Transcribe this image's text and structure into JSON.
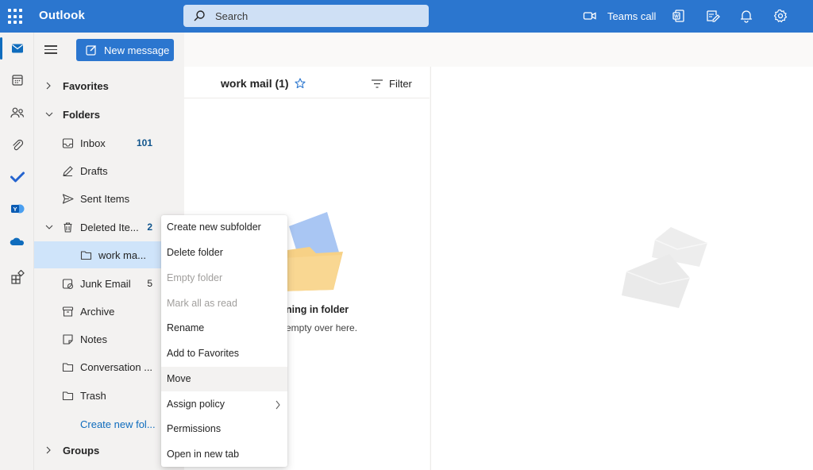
{
  "topbar": {
    "app_title": "Outlook",
    "search_placeholder": "Search",
    "teams_call_label": "Teams call",
    "icons": [
      "app-launcher-icon",
      "search-icon",
      "video-icon",
      "office-icon",
      "sticky-notes-icon",
      "bell-icon",
      "gear-icon"
    ]
  },
  "rail": {
    "items": [
      "mail",
      "calendar",
      "people",
      "attachments",
      "to-do",
      "yammer",
      "onedrive",
      "apps"
    ]
  },
  "folders": {
    "new_message_label": "New message",
    "favorites_label": "Favorites",
    "folders_label": "Folders",
    "groups_label": "Groups",
    "create_new_folder_label": "Create new fol...",
    "items": [
      {
        "label": "Inbox",
        "count": "101"
      },
      {
        "label": "Drafts",
        "count": ""
      },
      {
        "label": "Sent Items",
        "count": ""
      },
      {
        "label": "Deleted Ite...",
        "count": "2"
      },
      {
        "label": "work ma...",
        "count": ""
      },
      {
        "label": "Junk Email",
        "count": "5"
      },
      {
        "label": "Archive",
        "count": ""
      },
      {
        "label": "Notes",
        "count": ""
      },
      {
        "label": "Conversation ...",
        "count": ""
      },
      {
        "label": "Trash",
        "count": ""
      }
    ]
  },
  "message_list": {
    "title": "work mail (1)",
    "filter_label": "Filter",
    "empty_title": "ning in folder",
    "empty_subtitle": "empty over here."
  },
  "context_menu": {
    "items": [
      {
        "label": "Create new subfolder",
        "state": "enabled"
      },
      {
        "label": "Delete folder",
        "state": "enabled"
      },
      {
        "label": "Empty folder",
        "state": "disabled"
      },
      {
        "label": "Mark all as read",
        "state": "disabled"
      },
      {
        "label": "Rename",
        "state": "enabled"
      },
      {
        "label": "Add to Favorites",
        "state": "enabled"
      },
      {
        "label": "Move",
        "state": "hover"
      },
      {
        "label": "Assign policy",
        "state": "submenu"
      },
      {
        "label": "Permissions",
        "state": "enabled"
      },
      {
        "label": "Open in new tab",
        "state": "enabled"
      }
    ]
  },
  "colors": {
    "brand": "#2b76cf",
    "selected": "#cfe4fa",
    "accent_text": "#0f6cbd"
  }
}
